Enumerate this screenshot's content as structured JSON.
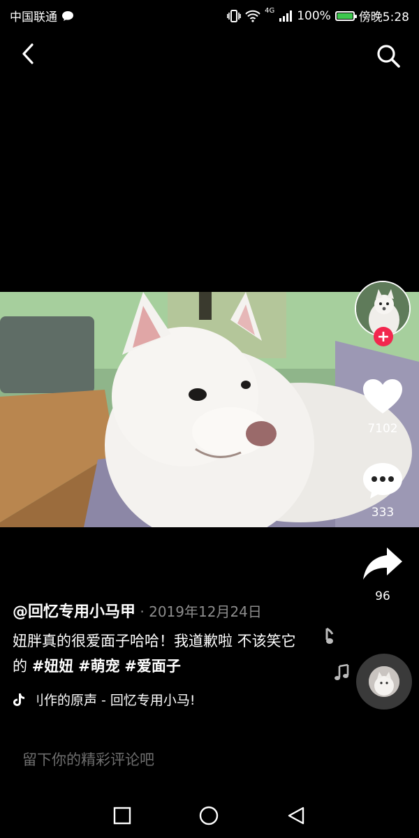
{
  "status_bar": {
    "carrier": "中国联通",
    "network": "4G",
    "battery": "100%",
    "time": "傍晚5:28"
  },
  "video": {
    "likes": "7102",
    "comments": "333",
    "shares": "96"
  },
  "caption": {
    "author": "@回忆专用小马甲",
    "separator": " · ",
    "date": "2019年12月24日",
    "text": "妞胖真的很爱面子哈哈！我道歉啦 不该笑它的 ",
    "tags": [
      "#妞妞",
      "#萌宠",
      "#爱面子"
    ],
    "music": "刂作的原声 - 回忆专用小马!"
  },
  "comment_input": {
    "placeholder": "留下你的精彩评论吧"
  },
  "colors": {
    "accent": "#f2274e",
    "battery": "#3ec64e",
    "background": "#000000"
  },
  "icons": [
    "back-icon",
    "search-icon",
    "heart-icon",
    "comment-icon",
    "share-icon",
    "music-note-icon",
    "tiktok-icon",
    "square-icon",
    "circle-icon",
    "triangle-icon"
  ]
}
